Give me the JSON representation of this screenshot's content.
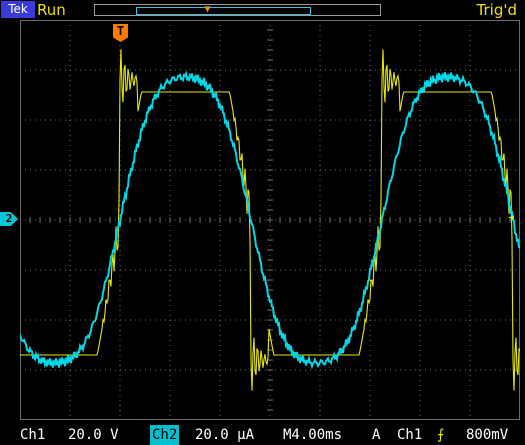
{
  "topbar": {
    "brand": "Tek",
    "run_state": "Run",
    "trigger_state": "Trig'd"
  },
  "markers": {
    "ch2_ground": "2",
    "trigger_position": "T",
    "trigger_level": "◄"
  },
  "status": {
    "ch1_label": "Ch1",
    "ch1_scale": "20.0 V",
    "ch2_label": "Ch2",
    "ch2_scale": "20.0 µA",
    "timebase": "M4.00ms",
    "trigger_mode": "A",
    "trigger_source": "Ch1",
    "trigger_slope_icon": "rising-edge-icon",
    "trigger_level": "800mV"
  },
  "colors": {
    "ch1": "#e8e800",
    "ch2": "#00d8e8",
    "grid": "#6a6a6a",
    "trigger": "#ff8c00"
  },
  "chart_data": {
    "type": "line",
    "grid": true,
    "divisions": {
      "x": 10,
      "y": 8
    },
    "series": [
      {
        "name": "Ch1",
        "description": "clipped quasi-square wave with ringing at transitions, period ≈ 16.5 ms"
      },
      {
        "name": "Ch2",
        "description": "noisy near-sinusoidal current waveform, period ≈ 16.5 ms"
      }
    ]
  }
}
